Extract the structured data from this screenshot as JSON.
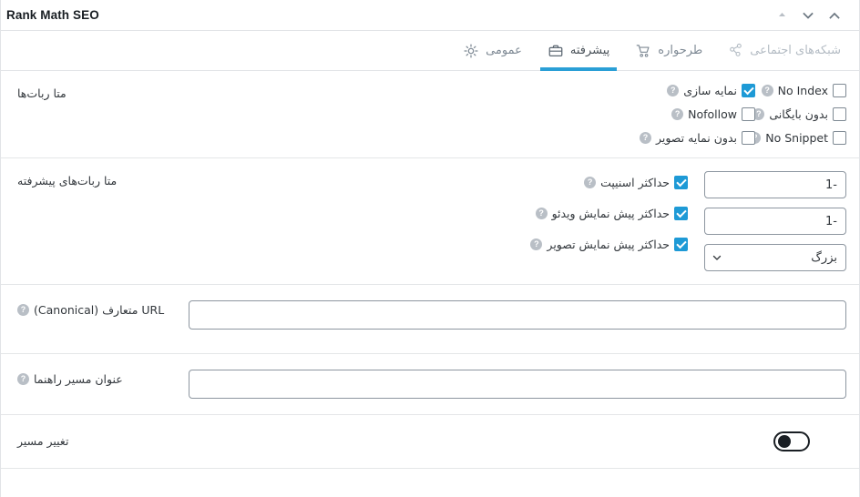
{
  "panel": {
    "title": "Rank Math SEO",
    "controls": [
      {
        "name": "move-up-small",
        "icon": "triangle-up-icon"
      },
      {
        "name": "move-down",
        "icon": "chevron-down-icon"
      },
      {
        "name": "move-up",
        "icon": "chevron-up-icon"
      }
    ]
  },
  "tabs": [
    {
      "label": "عمومی",
      "icon": "gear-icon",
      "state": "normal"
    },
    {
      "label": "پیشرفته",
      "icon": "briefcase-icon",
      "state": "active"
    },
    {
      "label": "طرحواره",
      "icon": "cart-icon",
      "state": "normal"
    },
    {
      "label": "شبکه‌های اجتماعی",
      "icon": "share-nodes-icon",
      "state": "muted"
    }
  ],
  "sections": {
    "meta_robots": {
      "label": "متا ربات‌ها",
      "help": "?",
      "col_right": [
        {
          "label": "نمایه سازی",
          "checked": true,
          "help": "?"
        },
        {
          "label": "Nofollow",
          "checked": false,
          "help": "?"
        },
        {
          "label": "بدون نمایه تصویر",
          "checked": false,
          "help": "?"
        }
      ],
      "col_left": [
        {
          "label": "No Index",
          "checked": false,
          "help": "?"
        },
        {
          "label": "بدون بایگانی",
          "checked": false,
          "help": "?"
        },
        {
          "label": "No Snippet",
          "checked": false,
          "help": "?"
        }
      ]
    },
    "advanced_robots": {
      "label": "متا ربات‌های پیشرفته",
      "help": "?",
      "rows": [
        {
          "label": "حداکثر اسنیپت",
          "checked": true,
          "help": "?",
          "control": "text",
          "value": "-1"
        },
        {
          "label": "حداکثر پیش نمایش ویدئو",
          "checked": true,
          "help": "?",
          "control": "text",
          "value": "-1"
        },
        {
          "label": "حداکثر پیش نمایش تصویر",
          "checked": true,
          "help": "?",
          "control": "select",
          "value": "بزرگ"
        }
      ]
    },
    "canonical": {
      "label": "URL متعارف (Canonical)",
      "help": "?",
      "value": "",
      "placeholder": ""
    },
    "breadcrumb": {
      "label": "عنوان مسیر راهنما",
      "help": "?",
      "value": "",
      "placeholder": ""
    },
    "redirect": {
      "label": "تغییر مسیر",
      "toggle_on": false
    }
  },
  "colors": {
    "accent": "#2a9fd6",
    "checkbox_checked": "#1e9ad6",
    "border": "#e2e4e7",
    "text": "#32373c",
    "muted": "#b4bcc4"
  }
}
